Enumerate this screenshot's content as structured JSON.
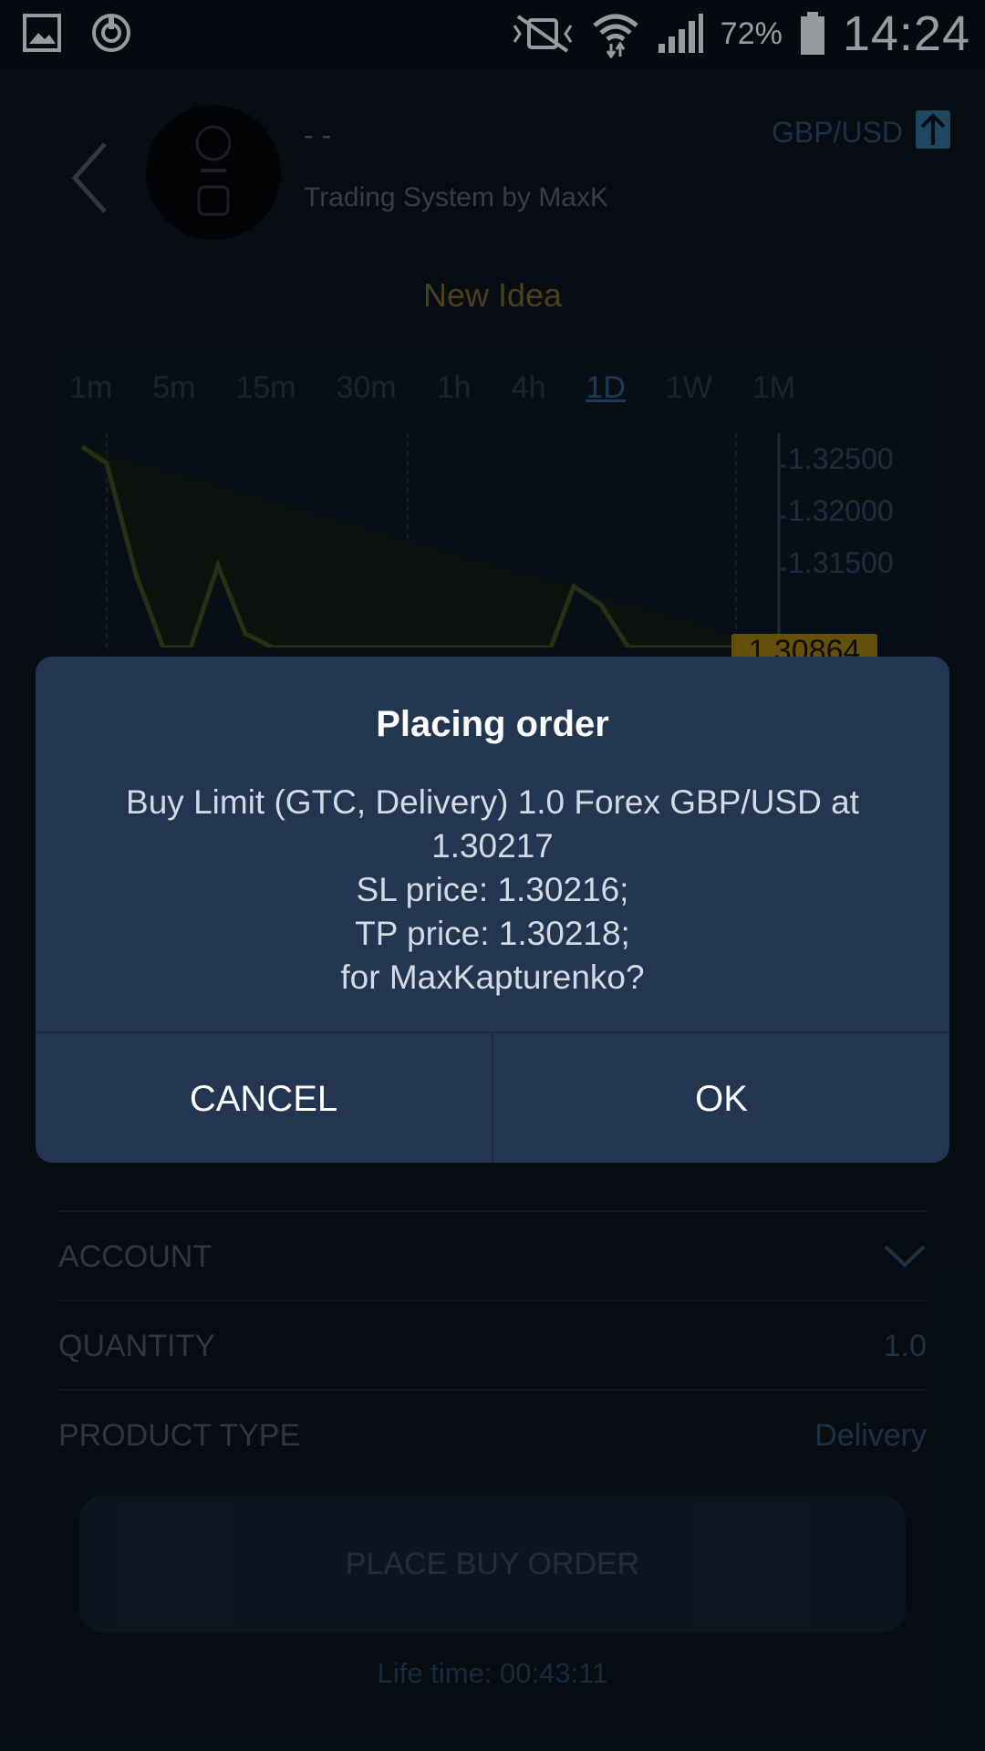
{
  "status_bar": {
    "battery": "72%",
    "time": "14:24",
    "icons": [
      "gallery-icon",
      "sync-icon",
      "mute-icon",
      "wifi-icon",
      "signal-icon",
      "battery-icon"
    ]
  },
  "header": {
    "author": "- -",
    "system": "Trading System by MaxK",
    "pair": "GBP/USD"
  },
  "new_idea": "New Idea",
  "chart": {
    "timeframes": [
      "1m",
      "5m",
      "15m",
      "30m",
      "1h",
      "4h",
      "1D",
      "1W",
      "1M"
    ],
    "active_timeframe": "1D",
    "price_ticks": [
      "1.32500",
      "1.32000",
      "1.31500"
    ],
    "current_price": "1.30864"
  },
  "form": {
    "account_label": "ACCOUNT",
    "quantity_label": "QUANTITY",
    "quantity_value": "1.0",
    "product_type_label": "PRODUCT TYPE",
    "product_type_value": "Delivery"
  },
  "place_button": "PLACE BUY ORDER",
  "lifetime": "Life time: 00:43:11",
  "dialog": {
    "title": "Placing order",
    "line1": "Buy Limit (GTC, Delivery) 1.0 Forex GBP/USD at",
    "line2": "1.30217",
    "line3": "SL price: 1.30216;",
    "line4": "TP price: 1.30218;",
    "line5": "for MaxKapturenko?",
    "cancel": "CANCEL",
    "ok": "OK"
  },
  "colors": {
    "background": "#0a0f17",
    "dialog_bg": "#223651",
    "accent_gold": "#9c7b12",
    "accent_blue": "#2f6c96"
  }
}
